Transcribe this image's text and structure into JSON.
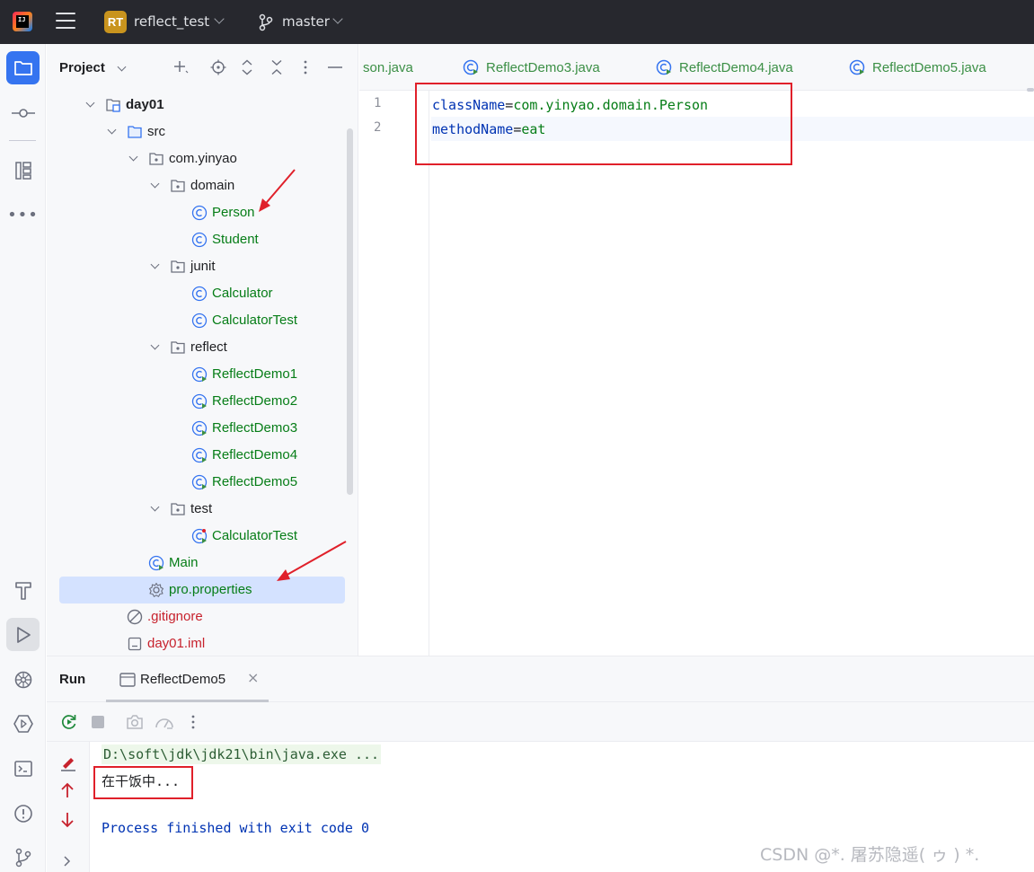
{
  "titlebar": {
    "project_badge": "RT",
    "project_name": "reflect_test",
    "branch": "master"
  },
  "project_panel": {
    "title": "Project",
    "tree": [
      {
        "label": "day01",
        "kind": "module",
        "bold": true
      },
      {
        "label": "src",
        "kind": "folder"
      },
      {
        "label": "com.yinyao",
        "kind": "package"
      },
      {
        "label": "domain",
        "kind": "package"
      },
      {
        "label": "Person",
        "kind": "class"
      },
      {
        "label": "Student",
        "kind": "class"
      },
      {
        "label": "junit",
        "kind": "package"
      },
      {
        "label": "Calculator",
        "kind": "class"
      },
      {
        "label": "CalculatorTest",
        "kind": "class"
      },
      {
        "label": "reflect",
        "kind": "package"
      },
      {
        "label": "ReflectDemo1",
        "kind": "runnable-class"
      },
      {
        "label": "ReflectDemo2",
        "kind": "runnable-class"
      },
      {
        "label": "ReflectDemo3",
        "kind": "runnable-class"
      },
      {
        "label": "ReflectDemo4",
        "kind": "runnable-class"
      },
      {
        "label": "ReflectDemo5",
        "kind": "runnable-class"
      },
      {
        "label": "test",
        "kind": "package"
      },
      {
        "label": "CalculatorTest",
        "kind": "test-class"
      },
      {
        "label": "Main",
        "kind": "runnable-class"
      },
      {
        "label": "pro.properties",
        "kind": "properties",
        "selected": true
      },
      {
        "label": ".gitignore",
        "kind": "ignore"
      },
      {
        "label": "day01.iml",
        "kind": "iml"
      }
    ]
  },
  "editor": {
    "tabs": [
      "son.java",
      "ReflectDemo3.java",
      "ReflectDemo4.java",
      "ReflectDemo5.java"
    ],
    "lines": [
      {
        "number": "1",
        "key": "className",
        "eq": "=",
        "value": "com.yinyao.domain.Person"
      },
      {
        "number": "2",
        "key": "methodName",
        "eq": "=",
        "value": "eat"
      }
    ]
  },
  "run_panel": {
    "title": "Run",
    "tab_label": "ReflectDemo5",
    "tab_close": "×",
    "console": {
      "command": "D:\\soft\\jdk\\jdk21\\bin\\java.exe ...",
      "output": "在干饭中...",
      "exit": "Process finished with exit code 0"
    }
  },
  "watermark": "CSDN @*. 屠苏隐遥( ゥ ) *.",
  "colors": {
    "accent": "#3574f0",
    "annotation_red": "#e0202a",
    "string_green": "#067d17",
    "keyword_blue": "#0033b3",
    "selection": "#d4e2ff"
  }
}
